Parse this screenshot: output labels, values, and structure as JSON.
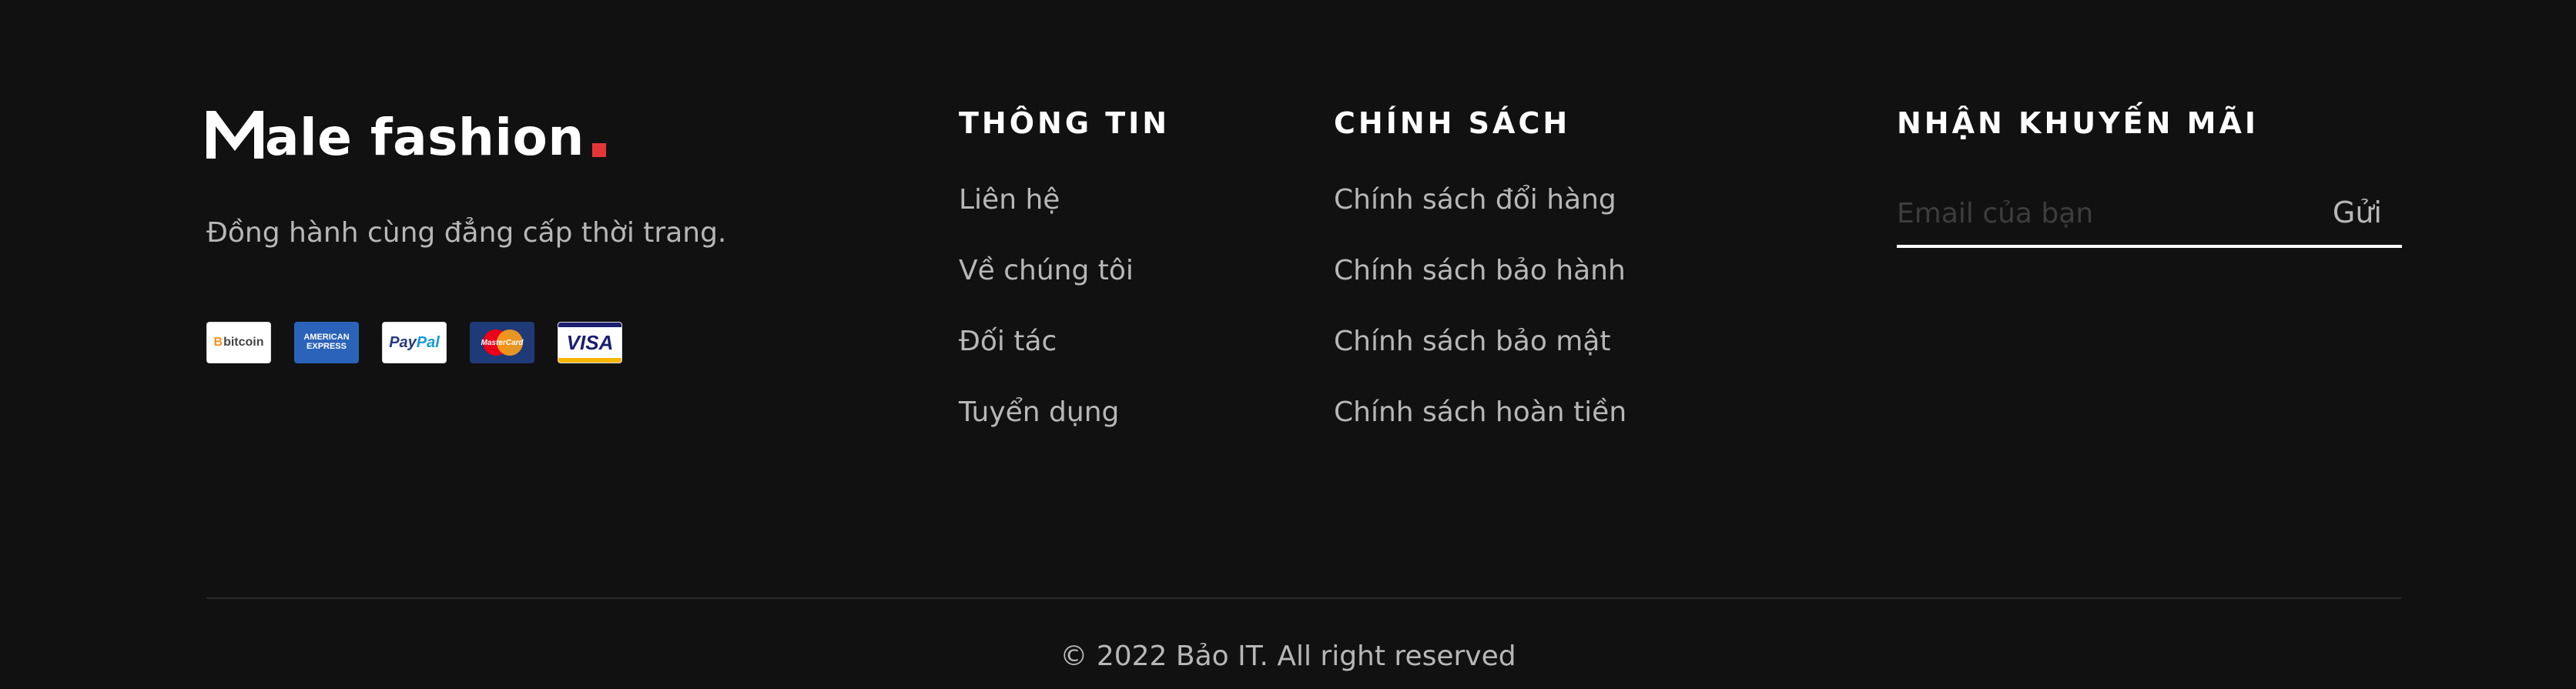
{
  "brand": {
    "name": "ale fashion",
    "logo_initial": "M",
    "accent_color": "#e53637",
    "tagline": "Đồng hành cùng đẳng cấp thời trang."
  },
  "payments": [
    {
      "icon": "bitcoin-icon",
      "label_b": "B",
      "label": "bitcoin"
    },
    {
      "icon": "amex-icon",
      "line1": "AMERICAN",
      "line2": "EXPRESS"
    },
    {
      "icon": "paypal-icon",
      "label_pay": "Pay",
      "label_pal": "Pal"
    },
    {
      "icon": "mastercard-icon",
      "label": "MasterCard"
    },
    {
      "icon": "visa-icon",
      "label": "VISA"
    }
  ],
  "info": {
    "title": "THÔNG TIN",
    "items": [
      "Liên hệ",
      "Về chúng tôi",
      "Đối tác",
      "Tuyển dụng"
    ]
  },
  "policy": {
    "title": "CHÍNH SÁCH",
    "items": [
      "Chính sách đổi hàng",
      "Chính sách bảo hành",
      "Chính sách bảo mật",
      "Chính sách hoàn tiền"
    ]
  },
  "promo": {
    "title": "NHẬN KHUYẾN MÃI",
    "email_placeholder": "Email của bạn",
    "email_value": "",
    "send_label": "Gửi"
  },
  "copyright": "© 2022 Bảo IT. All right reserved",
  "colors": {
    "background": "#111111",
    "text": "#b7b7b7",
    "heading": "#ffffff"
  }
}
